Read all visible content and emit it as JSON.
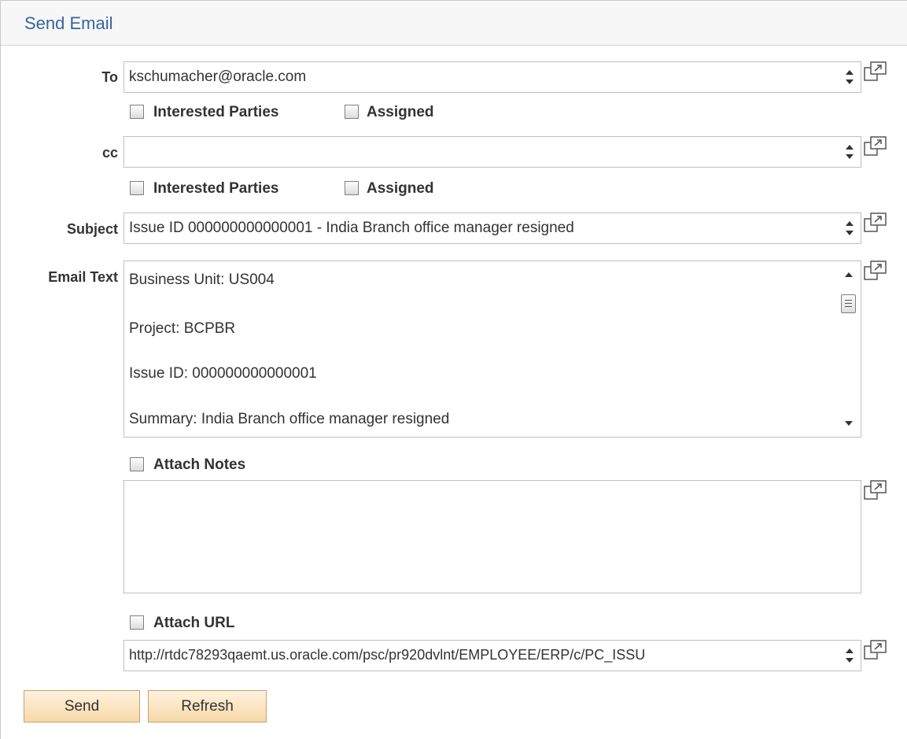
{
  "header": {
    "title": "Send Email"
  },
  "to": {
    "label": "To",
    "value": "kschumacher@oracle.com",
    "interested_parties": "Interested Parties",
    "assigned": "Assigned"
  },
  "cc": {
    "label": "cc",
    "value": "",
    "interested_parties": "Interested Parties",
    "assigned": "Assigned"
  },
  "subject": {
    "label": "Subject",
    "value": "Issue ID 000000000000001 - India Branch office manager resigned"
  },
  "email_text": {
    "label": "Email Text",
    "lines": [
      "Business Unit: US004",
      "Project: BCPBR",
      "Issue ID: 000000000000001",
      "Summary: India Branch office manager resigned"
    ]
  },
  "attach_notes": {
    "label": "Attach Notes",
    "value": ""
  },
  "attach_url": {
    "label": "Attach URL",
    "value": "http://rtdc78293qaemt.us.oracle.com/psc/pr920dvlnt/EMPLOYEE/ERP/c/PC_ISSU"
  },
  "buttons": {
    "send": "Send",
    "refresh": "Refresh"
  },
  "icons": {
    "expand": "expand-icon",
    "checkbox": "checkbox"
  },
  "colors": {
    "title": "#3a64a0",
    "button_top": "#fff2de",
    "button_bottom": "#f7d8a8"
  }
}
